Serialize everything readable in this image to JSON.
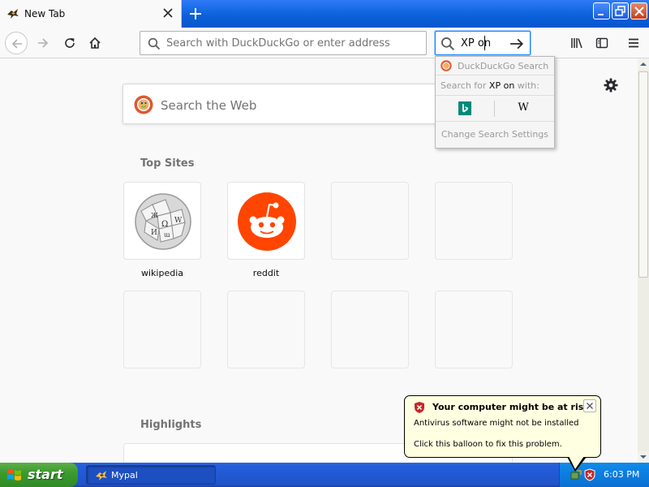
{
  "browser": {
    "tab": {
      "title": "New Tab",
      "favicon": "mypal-bird-icon"
    },
    "urlbar": {
      "placeholder": "Search with DuckDuckGo or enter address",
      "value": ""
    },
    "searchbar": {
      "value": "XP on"
    },
    "colors": {
      "titlebar": "#0a5fd8",
      "focus": "#0a84ff"
    }
  },
  "newtab": {
    "search_placeholder": "Search the Web",
    "top_sites_title": "Top Sites",
    "top_sites": [
      {
        "label": "wikipedia",
        "icon": "wikipedia-globe-icon"
      },
      {
        "label": "reddit",
        "icon": "reddit-alien-icon"
      },
      {
        "label": "",
        "icon": ""
      },
      {
        "label": "",
        "icon": ""
      },
      {
        "label": "",
        "icon": ""
      },
      {
        "label": "",
        "icon": ""
      },
      {
        "label": "",
        "icon": ""
      },
      {
        "label": "",
        "icon": ""
      }
    ],
    "highlights_title": "Highlights"
  },
  "search_dropdown": {
    "engine_header": "DuckDuckGo Search",
    "search_for_prefix": "Search for",
    "search_for_term": "XP on",
    "search_for_suffix": "with:",
    "engines": [
      {
        "name": "bing",
        "icon": "bing-icon"
      },
      {
        "name": "wikipedia",
        "icon": "wikipedia-w-icon",
        "glyph": "W"
      }
    ],
    "settings_label": "Change Search Settings"
  },
  "taskbar": {
    "start_label": "start",
    "tasks": [
      {
        "label": "Mypal"
      }
    ],
    "clock": "6:03 PM"
  },
  "balloon": {
    "title": "Your computer might be at risk",
    "line1": "Antivirus software might not be installed",
    "line2": "Click this balloon to fix this problem."
  }
}
